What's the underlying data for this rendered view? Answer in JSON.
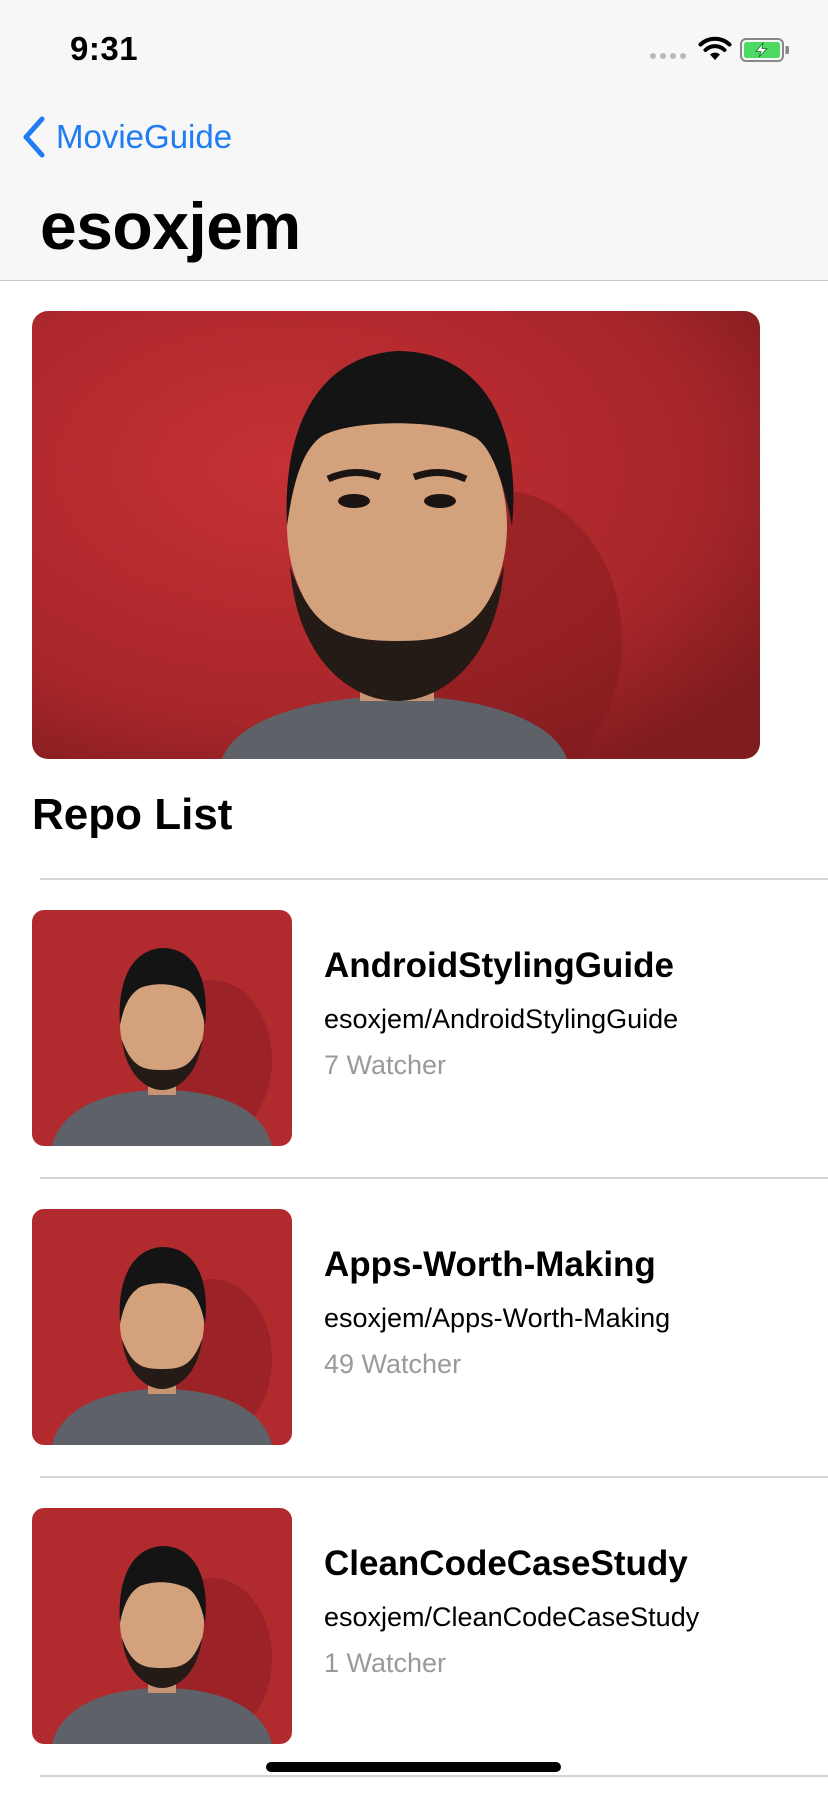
{
  "status_bar": {
    "time": "9:31"
  },
  "nav": {
    "back_label": "MovieGuide",
    "title": "esoxjem"
  },
  "profile": {
    "photo_icon": "person-photo"
  },
  "section": {
    "title": "Repo List"
  },
  "repos": [
    {
      "name": "AndroidStylingGuide",
      "full_name": "esoxjem/AndroidStylingGuide",
      "watchers": "7 Watcher"
    },
    {
      "name": "Apps-Worth-Making",
      "full_name": "esoxjem/Apps-Worth-Making",
      "watchers": "49 Watcher"
    },
    {
      "name": "CleanCodeCaseStudy",
      "full_name": "esoxjem/CleanCodeCaseStudy",
      "watchers": "1 Watcher"
    }
  ],
  "colors": {
    "accent": "#1f7cf2",
    "photo_background": "#b8282c",
    "battery_fill": "#4cd964"
  }
}
